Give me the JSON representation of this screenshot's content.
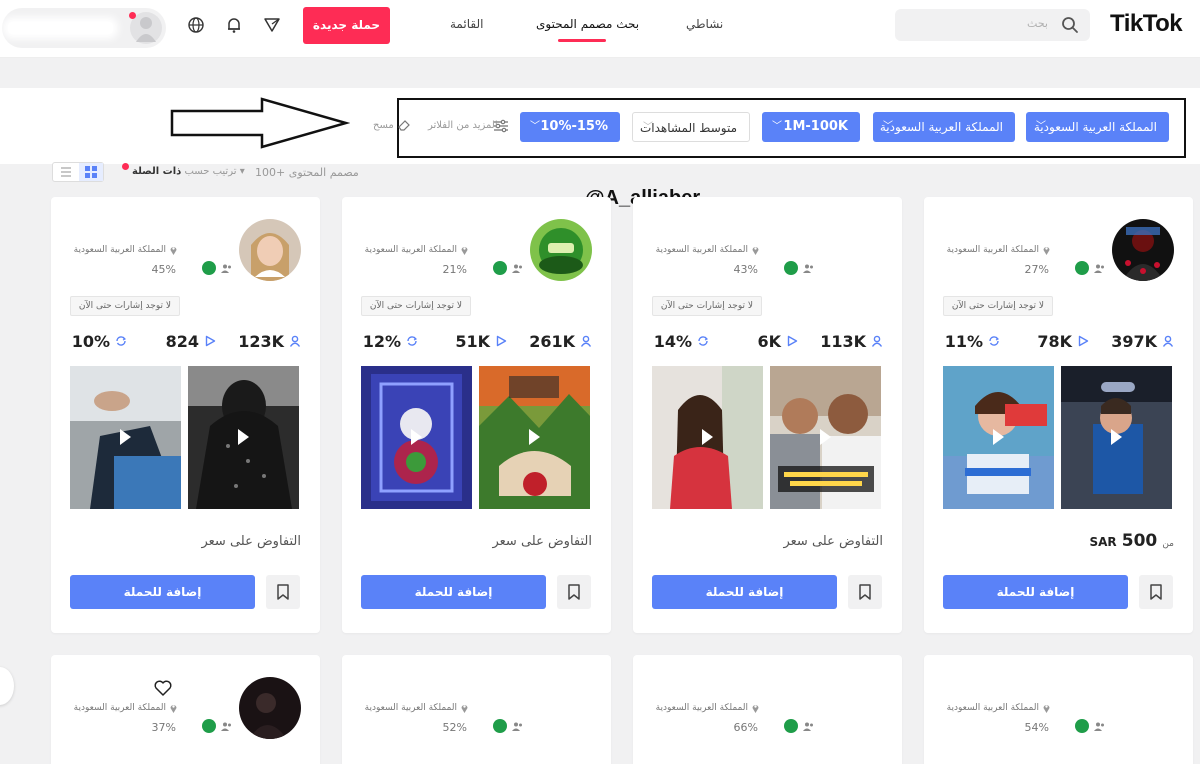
{
  "header": {
    "logo": "TikTok",
    "search_placeholder": "بحث",
    "nav": [
      "نشاطي",
      "بحث مصمم المحتوى",
      "القائمة"
    ],
    "new_campaign": "حملة جديدة"
  },
  "filters": {
    "chips": [
      "المملكة العربية السعودية",
      "المملكة العربية السعودية",
      "1M-100K",
      "متوسط المشاهدات",
      "10%-15%"
    ],
    "more_filters": "المزيد من الفلاتر",
    "clear": "مسح"
  },
  "results": {
    "count": "100+ مصمم المحتوى",
    "sort_prefix": "ترتيب حسب",
    "sort_value": "ذات الصلة"
  },
  "watermark": "@A_alljaber",
  "cards": [
    {
      "region": "المملكة العربية السعودية",
      "engagement": "27%",
      "signals": "لا توجد إشارات حتى الآن",
      "followers": "397K",
      "avg_views": "78K",
      "rate": "11%",
      "price_from": "من",
      "price": "500",
      "currency": "SAR",
      "add": "إضافة للحملة"
    },
    {
      "region": "المملكة العربية السعودية",
      "engagement": "43%",
      "signals": "لا توجد إشارات حتى الآن",
      "followers": "113K",
      "avg_views": "6K",
      "rate": "14%",
      "negotiate": "التفاوض على سعر",
      "add": "إضافة للحملة"
    },
    {
      "region": "المملكة العربية السعودية",
      "engagement": "21%",
      "signals": "لا توجد إشارات حتى الآن",
      "followers": "261K",
      "avg_views": "51K",
      "rate": "12%",
      "negotiate": "التفاوض على سعر",
      "add": "إضافة للحملة"
    },
    {
      "region": "المملكة العربية السعودية",
      "engagement": "45%",
      "signals": "لا توجد إشارات حتى الآن",
      "followers": "123K",
      "avg_views": "824",
      "rate": "10%",
      "negotiate": "التفاوض على سعر",
      "add": "إضافة للحملة"
    }
  ],
  "cards_row2": [
    {
      "region": "المملكة العربية السعودية",
      "engagement": "54%"
    },
    {
      "region": "المملكة العربية السعودية",
      "engagement": "66%"
    },
    {
      "region": "المملكة العربية السعودية",
      "engagement": "52%"
    },
    {
      "region": "المملكة العربية السعودية",
      "engagement": "37%"
    }
  ],
  "colors": {
    "brand_red": "#fe2c55",
    "accent_blue": "#5a82f8",
    "flag_green": "#1f9d49"
  }
}
